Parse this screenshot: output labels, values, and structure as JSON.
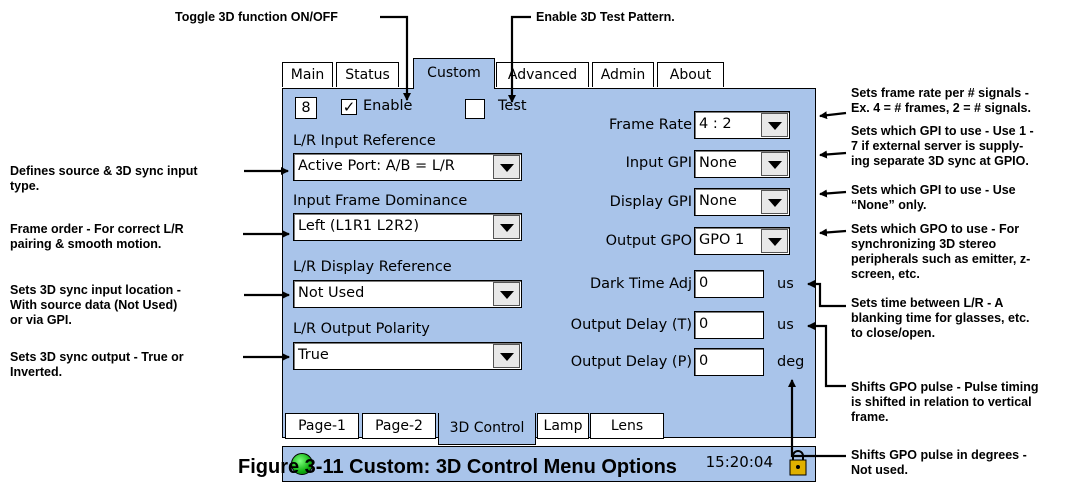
{
  "annotations": {
    "toggle_3d": "Toggle 3D function ON/OFF",
    "enable_test": "Enable 3D Test Pattern.",
    "defines_source": [
      "Defines source & 3D sync input",
      "type."
    ],
    "frame_order": [
      "Frame order - For correct L/R",
      "pairing & smooth motion."
    ],
    "sync_input_location": [
      "Sets 3D sync input location -",
      "With source data (Not Used)",
      "or via GPI."
    ],
    "sync_output": [
      "Sets 3D sync output - True or",
      "Inverted."
    ],
    "frame_rate": [
      "Sets frame rate per # signals -",
      "Ex. 4 = # frames, 2 = # signals."
    ],
    "which_gpi": [
      "Sets which GPI to use - Use 1 -",
      "7 if external server is supply-",
      "ing separate 3D sync at GPIO."
    ],
    "which_gpi_none": [
      "Sets which GPI to use - Use",
      "“None” only."
    ],
    "which_gpo": [
      "Sets which GPO to use - For",
      "synchronizing 3D stereo",
      "peripherals such as emitter, z-",
      "screen, etc."
    ],
    "blanking_time": [
      "Sets time between L/R - A",
      "blanking time for glasses, etc.",
      "to close/open."
    ],
    "gpo_pulse_shift": [
      "Shifts GPO pulse - Pulse timing",
      "is shifted in relation to vertical",
      "frame."
    ],
    "gpo_pulse_degrees": [
      "Shifts GPO pulse in degrees -",
      "Not used."
    ]
  },
  "top_tabs": [
    "Main",
    "Status",
    "Custom",
    "Advanced",
    "Admin",
    "About"
  ],
  "active_top_tab": "Custom",
  "panel": {
    "channel_number": "8",
    "enable_label": "Enable",
    "enable_checked": true,
    "test_label": "Test",
    "test_checked": false,
    "lr_input_reference": {
      "label": "L/R Input Reference",
      "value": "Active Port: A/B = L/R"
    },
    "input_frame_dominance": {
      "label": "Input Frame Dominance",
      "value": "Left (L1R1 L2R2)"
    },
    "lr_display_reference": {
      "label": "L/R Display Reference",
      "value": "Not Used"
    },
    "lr_output_polarity": {
      "label": "L/R Output Polarity",
      "value": "True"
    },
    "frame_rate": {
      "label": "Frame Rate",
      "value": "4 : 2"
    },
    "input_gpi": {
      "label": "Input GPI",
      "value": "None"
    },
    "display_gpi": {
      "label": "Display GPI",
      "value": "None"
    },
    "output_gpo": {
      "label": "Output GPO",
      "value": "GPO 1"
    },
    "dark_time_adj": {
      "label": "Dark Time Adj",
      "value": "0",
      "unit": "us"
    },
    "output_delay_t": {
      "label": "Output Delay (T)",
      "value": "0",
      "unit": "us"
    },
    "output_delay_p": {
      "label": "Output Delay (P)",
      "value": "0",
      "unit": "deg"
    }
  },
  "bottom_tabs": [
    "Page-1",
    "Page-2",
    "3D Control",
    "Lamp",
    "Lens"
  ],
  "active_bottom_tab": "3D Control",
  "status_bar": {
    "time": "15:20:04",
    "led_color": "#22cc22"
  },
  "caption": "Figure 3-11 Custom: 3D Control Menu Options"
}
